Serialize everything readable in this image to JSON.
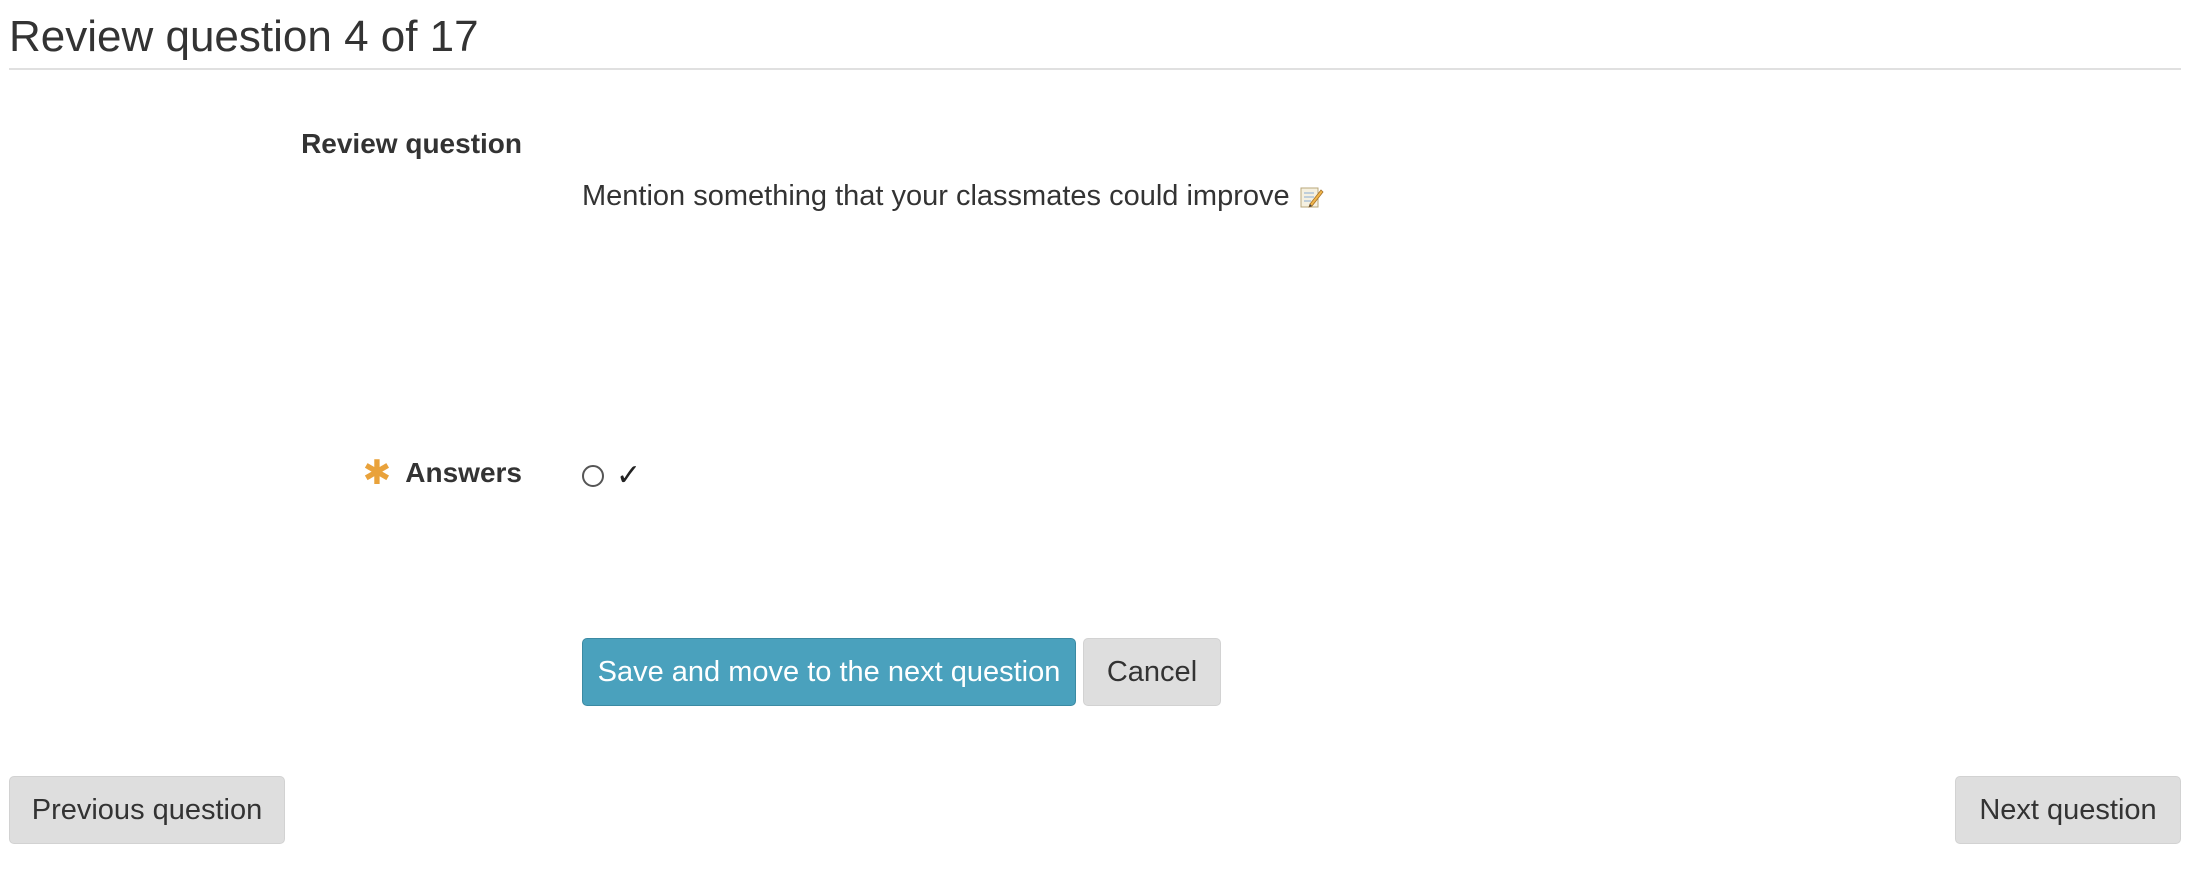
{
  "header": {
    "title": "Review question 4 of 17"
  },
  "form": {
    "review_label": "Review question",
    "question_text": "Mention something that your classmates could improve",
    "question_icon": "memo-icon",
    "answers_label": "Answers",
    "answers_required_icon": "asterisk-icon",
    "answer_options": [
      {
        "label": "✓",
        "selected": false
      }
    ],
    "required_color": "#e9a23b"
  },
  "actions": {
    "save_label": "Save and move to the next question",
    "cancel_label": "Cancel",
    "primary_color": "#4aa1bd"
  },
  "navigation": {
    "previous_label": "Previous question",
    "next_label": "Next question"
  }
}
